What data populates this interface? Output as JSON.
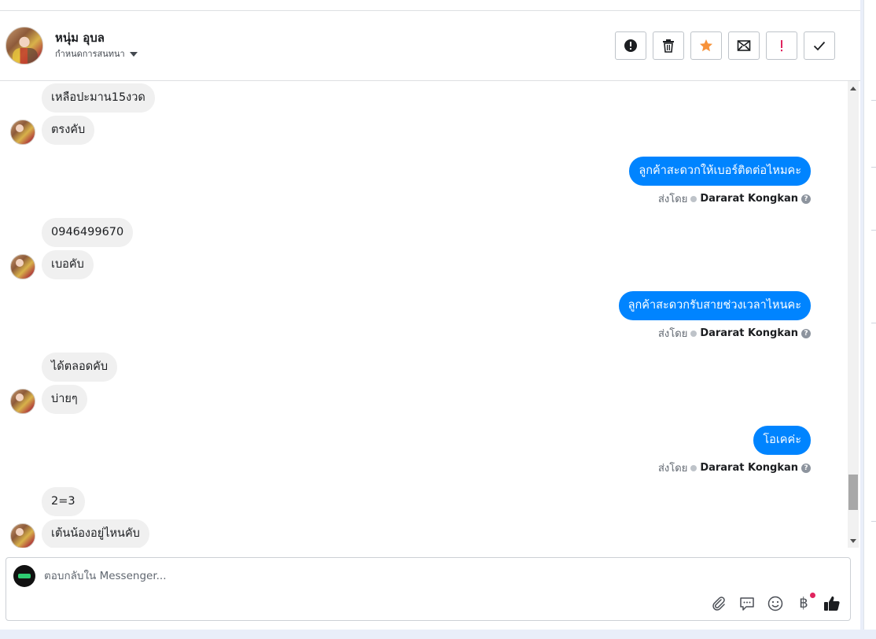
{
  "header": {
    "user_name": "หนุ่ม อุบล",
    "conversation_setting": "กำหนดการสนทนา",
    "toolbar": [
      {
        "name": "report-spam-button",
        "icon": "alert-circle-icon",
        "color": "#1c1e21"
      },
      {
        "name": "delete-button",
        "icon": "trash-icon",
        "color": "#1c1e21"
      },
      {
        "name": "star-button",
        "icon": "star-icon",
        "color": "#f7923a"
      },
      {
        "name": "mark-unread-button",
        "icon": "mail-icon",
        "color": "#1c1e21"
      },
      {
        "name": "follow-up-button",
        "icon": "exclamation-icon",
        "color": "#e0245e"
      },
      {
        "name": "mark-done-button",
        "icon": "check-icon",
        "color": "#1c1e21"
      }
    ]
  },
  "messages": [
    {
      "side": "in",
      "text": "เหลือปะมาน15งวด"
    },
    {
      "side": "in",
      "text": "ตรงคับ"
    },
    {
      "side": "out",
      "text": "ลูกค้าสะดวกให้เบอร์ติดต่อไหมคะ"
    },
    {
      "side": "in",
      "text": "0946499670"
    },
    {
      "side": "in",
      "text": "เบอคับ"
    },
    {
      "side": "out",
      "text": "ลูกค้าสะดวกรับสายช่วงเวลาไหนคะ"
    },
    {
      "side": "in",
      "text": "ได้ตลอดคับ"
    },
    {
      "side": "in",
      "text": "บ่ายๆ"
    },
    {
      "side": "out",
      "text": "โอเคค่ะ"
    },
    {
      "side": "in",
      "text": "2=3"
    },
    {
      "side": "in",
      "text": "เต้นน้องอยู่ไหนคับ"
    }
  ],
  "sent_by": {
    "label": "ส่งโดย",
    "agent": "Dararat Kongkan"
  },
  "composer": {
    "placeholder": "ตอบกลับใน Messenger..."
  },
  "colors": {
    "accent": "#0084ff",
    "star": "#f7923a",
    "alert": "#e0245e"
  }
}
